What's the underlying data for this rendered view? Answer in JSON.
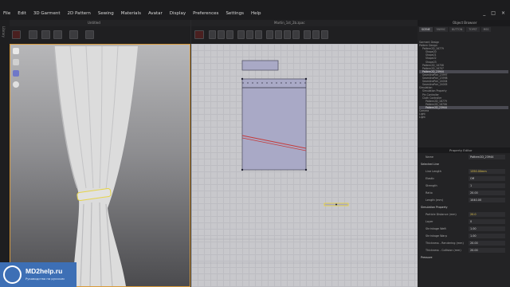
{
  "menu": {
    "items": [
      "File",
      "Edit",
      "3D Garment",
      "2D Pattern",
      "Sewing",
      "Materials",
      "Avatar",
      "Display",
      "Preferences",
      "Settings",
      "Help"
    ],
    "window_buttons": [
      "_",
      "□",
      "×"
    ]
  },
  "left_strip": {
    "label": "Library"
  },
  "viewport_3d": {
    "title": "Untitled"
  },
  "viewport_2d": {
    "title": "Martin_1st_2b.zpac"
  },
  "object_browser": {
    "title": "Object Browser",
    "tabs": [
      "SCENE",
      "FABRIC",
      "BUTTON",
      "TOPST",
      "MSS"
    ],
    "tree": [
      {
        "label": "Garment Design"
      },
      {
        "label": "Pattern Design"
      },
      {
        "label": "Pattern2D_16779"
      },
      {
        "label": "Shape20"
      },
      {
        "label": "Shape21"
      },
      {
        "label": "Shape22"
      },
      {
        "label": "Shape23"
      },
      {
        "label": "Pattern2D_16706"
      },
      {
        "label": "Pattern2D_16707"
      },
      {
        "label": "Pattern2D_23944",
        "selected": true
      },
      {
        "label": "SeamlinePair_23997"
      },
      {
        "label": "SeamlinePair_23998"
      },
      {
        "label": "SeamlinePair_24004"
      },
      {
        "label": "SeamlinePair_24005"
      },
      {
        "label": "Simulation"
      },
      {
        "label": "Simulation Property"
      },
      {
        "label": "Pin Controller"
      },
      {
        "label": "Cloth Controller"
      },
      {
        "label": "Pattern2D_16779"
      },
      {
        "label": "Pattern2D_16706"
      },
      {
        "label": "Pattern2D_23944",
        "selected": true
      },
      {
        "label": "Camera"
      },
      {
        "label": "Light"
      },
      {
        "label": "Light"
      }
    ]
  },
  "property_editor": {
    "title": "Property Editor",
    "rows": [
      {
        "label": "Name",
        "value": "Pattern2D_23944",
        "section": false,
        "highlight": false
      },
      {
        "label": "Selected Line",
        "value": "",
        "section": true,
        "highlight": false
      },
      {
        "label": "Line Length",
        "value": "1350.00mm",
        "section": false,
        "highlight": true
      },
      {
        "label": "Elastic",
        "value": "Off",
        "section": false,
        "highlight": false
      },
      {
        "label": "Strength",
        "value": "1",
        "section": false,
        "highlight": false
      },
      {
        "label": "Ratio",
        "value": "20.00",
        "section": false,
        "highlight": false
      },
      {
        "label": "Length (mm)",
        "value": "1040.00",
        "section": false,
        "highlight": false
      },
      {
        "label": "Simulation Property",
        "value": "",
        "section": true,
        "highlight": false
      },
      {
        "label": "Particle Distance (mm)",
        "value": "20.0",
        "section": false,
        "highlight": true
      },
      {
        "label": "Layer",
        "value": "0",
        "section": false,
        "highlight": false
      },
      {
        "label": "Shrinkage Weft",
        "value": "1.00",
        "section": false,
        "highlight": false
      },
      {
        "label": "Shrinkage Warp",
        "value": "1.00",
        "section": false,
        "highlight": false
      },
      {
        "label": "Thickness - Rendering (mm)",
        "value": "20.00",
        "section": false,
        "highlight": false
      },
      {
        "label": "Thickness - Collision (mm)",
        "value": "20.00",
        "section": false,
        "highlight": false
      },
      {
        "label": "Pressure",
        "value": "",
        "section": true,
        "highlight": false
      }
    ]
  },
  "watermark": {
    "title": "MD2help.ru",
    "subtitle": "Руководство на русском"
  },
  "colors": {
    "panel_dark": "#1f1f21",
    "grid_bg": "#c8c8cc",
    "pattern_fill": "#a9a9c6",
    "seam_red": "#c53a3a",
    "selected_yellow": "#e6d44a",
    "viewport_border": "#d89a3a",
    "logo_blue": "#3d6fb5"
  }
}
